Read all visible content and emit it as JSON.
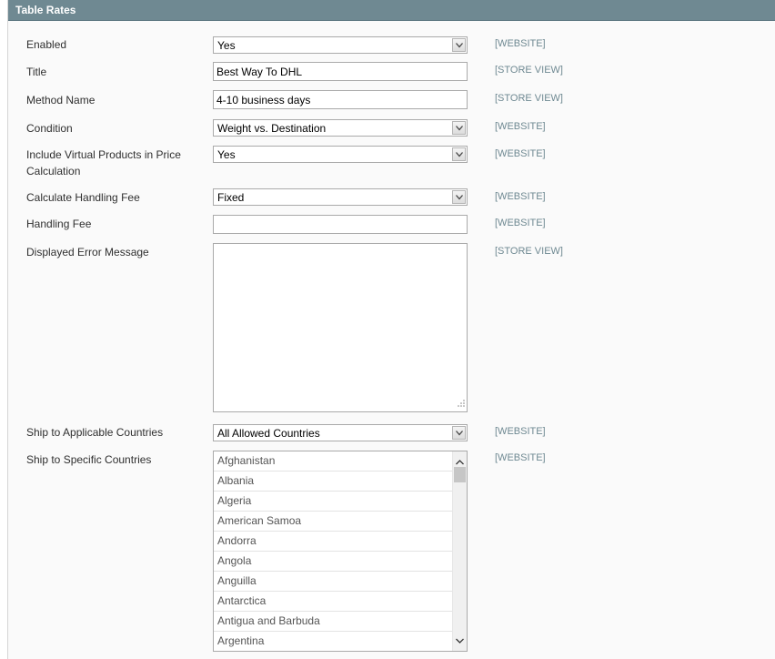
{
  "section": {
    "title": "Table Rates"
  },
  "fields": {
    "enabled": {
      "label": "Enabled",
      "value": "Yes",
      "scope": "[WEBSITE]"
    },
    "title": {
      "label": "Title",
      "value": "Best Way To DHL",
      "scope": "[STORE VIEW]"
    },
    "method_name": {
      "label": "Method Name",
      "value": "4-10 business days",
      "scope": "[STORE VIEW]"
    },
    "condition": {
      "label": "Condition",
      "value": "Weight vs. Destination",
      "scope": "[WEBSITE]"
    },
    "include_virtual": {
      "label": "Include Virtual Products in Price Calculation",
      "value": "Yes",
      "scope": "[WEBSITE]"
    },
    "handling_fee_type": {
      "label": "Calculate Handling Fee",
      "value": "Fixed",
      "scope": "[WEBSITE]"
    },
    "handling_fee": {
      "label": "Handling Fee",
      "value": "",
      "scope": "[WEBSITE]"
    },
    "error_message": {
      "label": "Displayed Error Message",
      "value": "",
      "scope": "[STORE VIEW]"
    },
    "applicable_countries": {
      "label": "Ship to Applicable Countries",
      "value": "All Allowed Countries",
      "scope": "[WEBSITE]"
    },
    "specific_countries": {
      "label": "Ship to Specific Countries",
      "scope": "[WEBSITE]",
      "options": [
        "Afghanistan",
        "Albania",
        "Algeria",
        "American Samoa",
        "Andorra",
        "Angola",
        "Anguilla",
        "Antarctica",
        "Antigua and Barbuda",
        "Argentina"
      ]
    }
  },
  "icons": {
    "select_arrow": "chevron-down-icon",
    "resize": "resize-grip-icon",
    "scroll_up": "chevron-up-icon",
    "scroll_down": "chevron-down-icon"
  },
  "colors": {
    "header": "#6f8992",
    "scope_text": "#6f8992",
    "background": "#fafafa"
  }
}
